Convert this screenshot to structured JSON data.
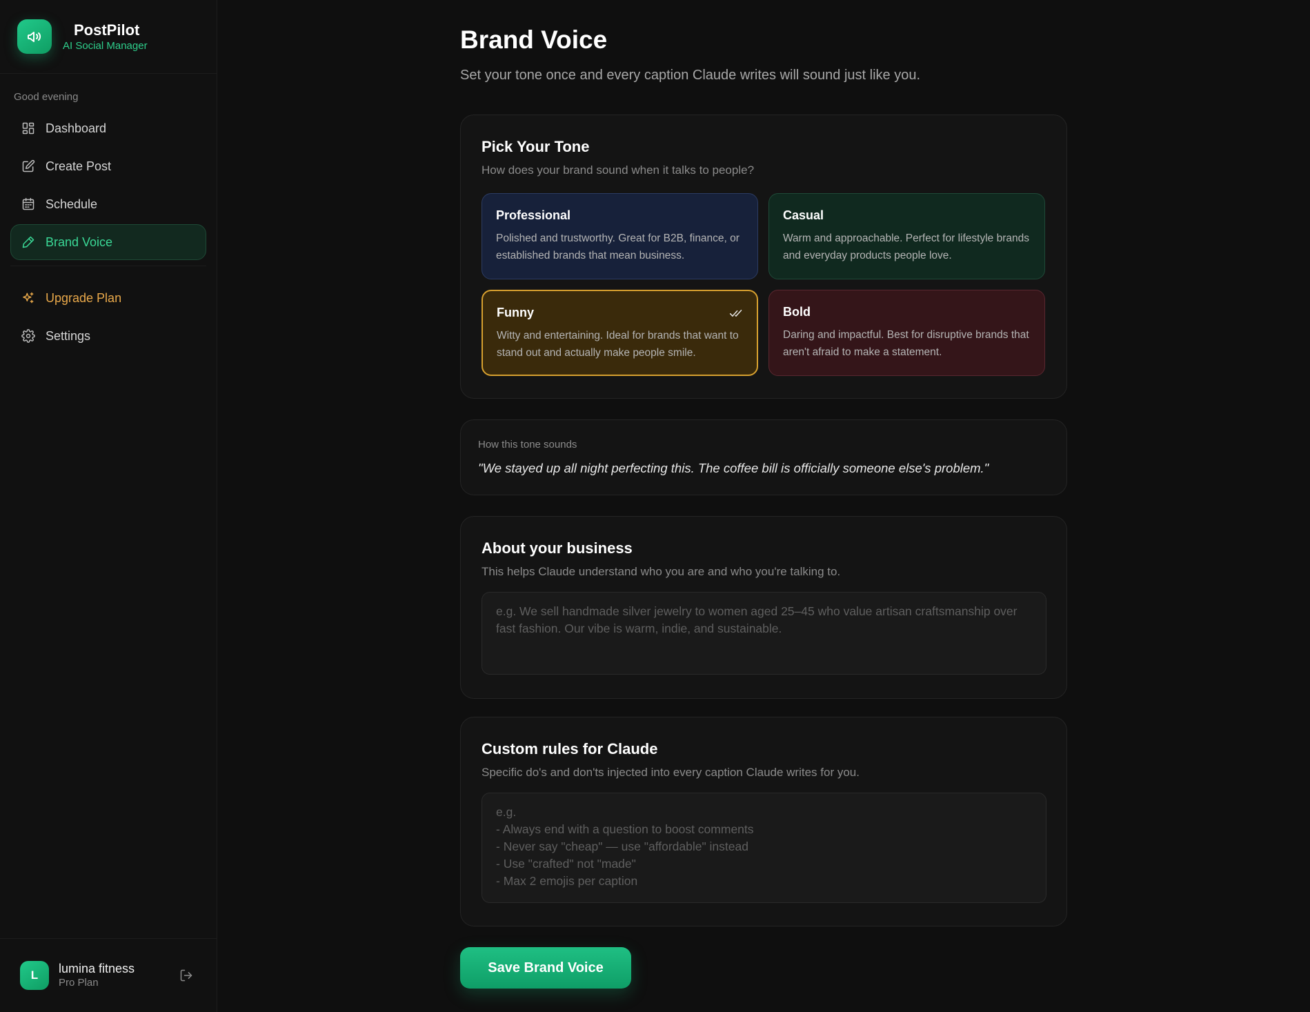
{
  "app": {
    "name": "PostPilot",
    "tagline": "AI Social Manager",
    "greeting": "Good evening"
  },
  "nav": {
    "dashboard": "Dashboard",
    "create_post": "Create Post",
    "schedule": "Schedule",
    "brand_voice": "Brand Voice",
    "upgrade": "Upgrade Plan",
    "settings": "Settings"
  },
  "user": {
    "initial": "L",
    "name": "lumina fitness",
    "plan": "Pro Plan"
  },
  "page": {
    "title": "Brand Voice",
    "subtitle": "Set your tone once and every caption Claude writes will sound just like you."
  },
  "tone": {
    "title": "Pick Your Tone",
    "subtitle": "How does your brand sound when it talks to people?",
    "selected": "Funny",
    "options": [
      {
        "name": "Professional",
        "description": "Polished and trustworthy. Great for B2B, finance, or established brands that mean business."
      },
      {
        "name": "Casual",
        "description": "Warm and approachable. Perfect for lifestyle brands and everyday products people love."
      },
      {
        "name": "Funny",
        "description": "Witty and entertaining. Ideal for brands that want to stand out and actually make people smile."
      },
      {
        "name": "Bold",
        "description": "Daring and impactful. Best for disruptive brands that aren't afraid to make a statement."
      }
    ]
  },
  "sample": {
    "label": "How this tone sounds",
    "quote": "\"We stayed up all night perfecting this. The coffee bill is officially someone else's problem.\""
  },
  "about": {
    "title": "About your business",
    "subtitle": "This helps Claude understand who you are and who you're talking to.",
    "value": "",
    "placeholder": "e.g. We sell handmade silver jewelry to women aged 25–45 who value artisan craftsmanship over fast fashion. Our vibe is warm, indie, and sustainable."
  },
  "custom_rules": {
    "title": "Custom rules for Claude",
    "subtitle": "Specific do's and don'ts injected into every caption Claude writes for you.",
    "value": "",
    "placeholder": "e.g.\n- Always end with a question to boost comments\n- Never say \"cheap\" — use \"affordable\" instead\n- Use \"crafted\" not \"made\"\n- Max 2 emojis per caption"
  },
  "actions": {
    "save_label": "Save Brand Voice"
  },
  "colors": {
    "accent": "#1fbf83",
    "active_nav_text": "#3ad896",
    "upgrade": "#e8a84a",
    "selected_border": "#d8a12f"
  },
  "icons": {
    "logo": "megaphone-icon",
    "dashboard": "grid-icon",
    "create_post": "edit-icon",
    "schedule": "calendar-icon",
    "brand_voice": "pen-icon",
    "upgrade": "sparkles-icon",
    "settings": "gear-icon",
    "logout": "logout-icon",
    "selected": "double-check-icon"
  }
}
